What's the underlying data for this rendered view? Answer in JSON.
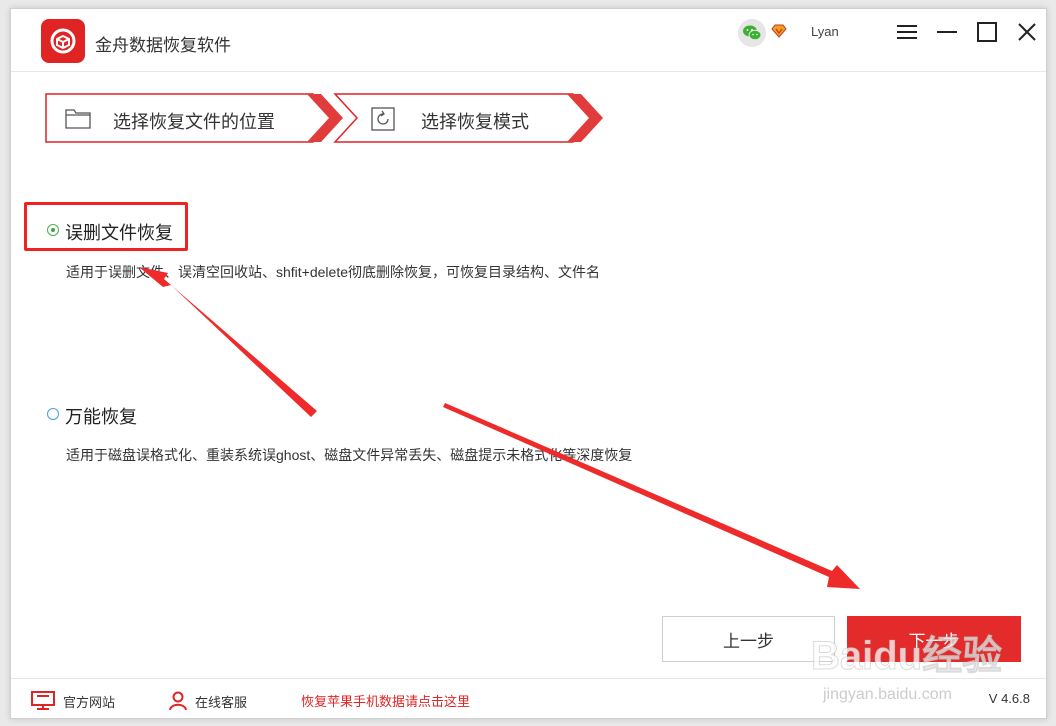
{
  "app": {
    "title": "金舟数据恢复软件",
    "username": "Lyan",
    "accent": "#e02323"
  },
  "steps": [
    {
      "label": "选择恢复文件的位置",
      "icon": "folder-icon"
    },
    {
      "label": "选择恢复模式",
      "icon": "restore-icon"
    }
  ],
  "options": [
    {
      "title": "误删文件恢复",
      "desc": "适用于误删文件、误清空回收站、shfit+delete彻底删除恢复，可恢复目录结构、文件名",
      "selected": true
    },
    {
      "title": "万能恢复",
      "desc": "适用于磁盘误格式化、重装系统误ghost、磁盘文件异常丢失、磁盘提示未格式化等深度恢复",
      "selected": false
    }
  ],
  "buttons": {
    "prev": "上一步",
    "next": "下一步"
  },
  "footer": {
    "official_site": "官方网站",
    "online_service": "在线客服",
    "apple_link": "恢复苹果手机数据请点击这里",
    "version": "V 4.6.8"
  },
  "watermark": {
    "brand": "Baidu经验",
    "url": "jingyan.baidu.com"
  }
}
